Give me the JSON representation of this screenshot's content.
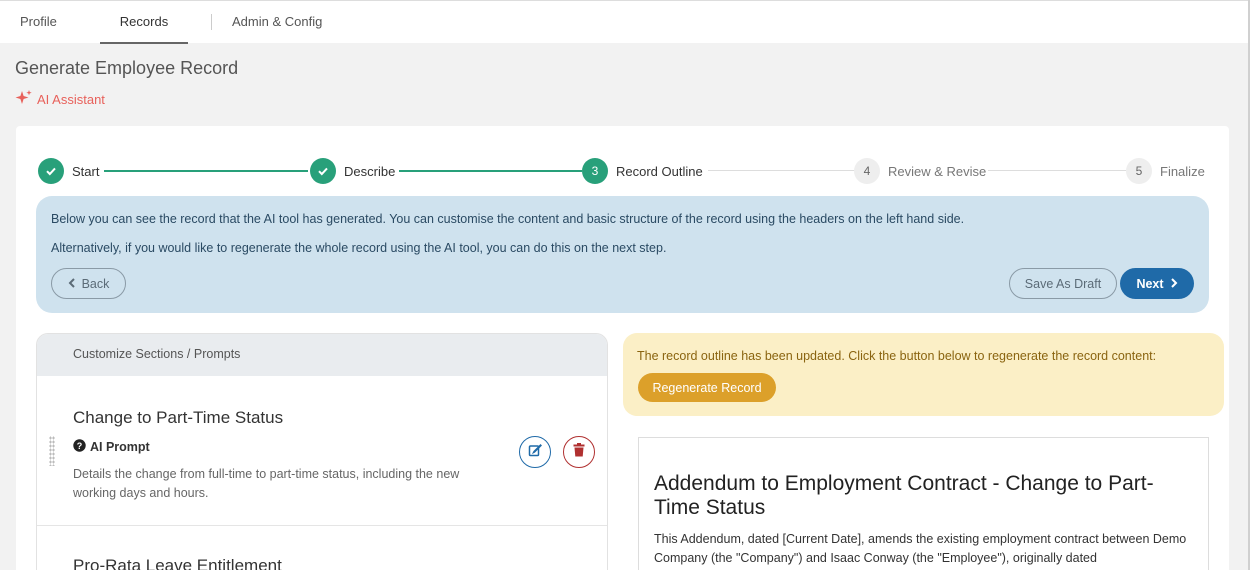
{
  "tabs": [
    {
      "label": "Profile"
    },
    {
      "label": "Records"
    },
    {
      "label": "Admin & Config"
    }
  ],
  "page_title": "Generate Employee Record",
  "ai_assistant": {
    "label": "AI Assistant",
    "icon": "sparkle-icon",
    "color": "#e8615b"
  },
  "stepper": {
    "accent": "#28a07a",
    "steps": [
      {
        "label": "Start",
        "state": "done"
      },
      {
        "label": "Describe",
        "state": "done"
      },
      {
        "num": "3",
        "label": "Record Outline",
        "state": "current"
      },
      {
        "num": "4",
        "label": "Review & Revise",
        "state": "todo"
      },
      {
        "num": "5",
        "label": "Finalize",
        "state": "todo"
      }
    ]
  },
  "info": {
    "line1": "Below you can see the record that the AI tool has generated. You can customise the content and basic structure of the record using the headers on the left hand side.",
    "line2": "Alternatively, if you would like to regenerate the whole record using the AI tool, you can do this on the next step.",
    "back_label": "Back",
    "save_draft_label": "Save As Draft",
    "next_label": "Next"
  },
  "sections_panel": {
    "header": "Customize Sections / Prompts",
    "sections": [
      {
        "title": "Change to Part-Time Status",
        "prompt_label": "AI Prompt",
        "description": "Details the change from full-time to part-time status, including the new working days and hours."
      },
      {
        "title": "Pro-Rata Leave Entitlement"
      }
    ]
  },
  "notice": {
    "text": "The record outline has been updated. Click the button below to regenerate the record content:",
    "button_label": "Regenerate Record"
  },
  "document": {
    "heading": "Addendum to Employment Contract - Change to Part-Time Status",
    "body": "This Addendum, dated [Current Date], amends the existing employment contract between Demo Company (the \"Company\") and Isaac Conway (the \"Employee\"), originally dated"
  }
}
